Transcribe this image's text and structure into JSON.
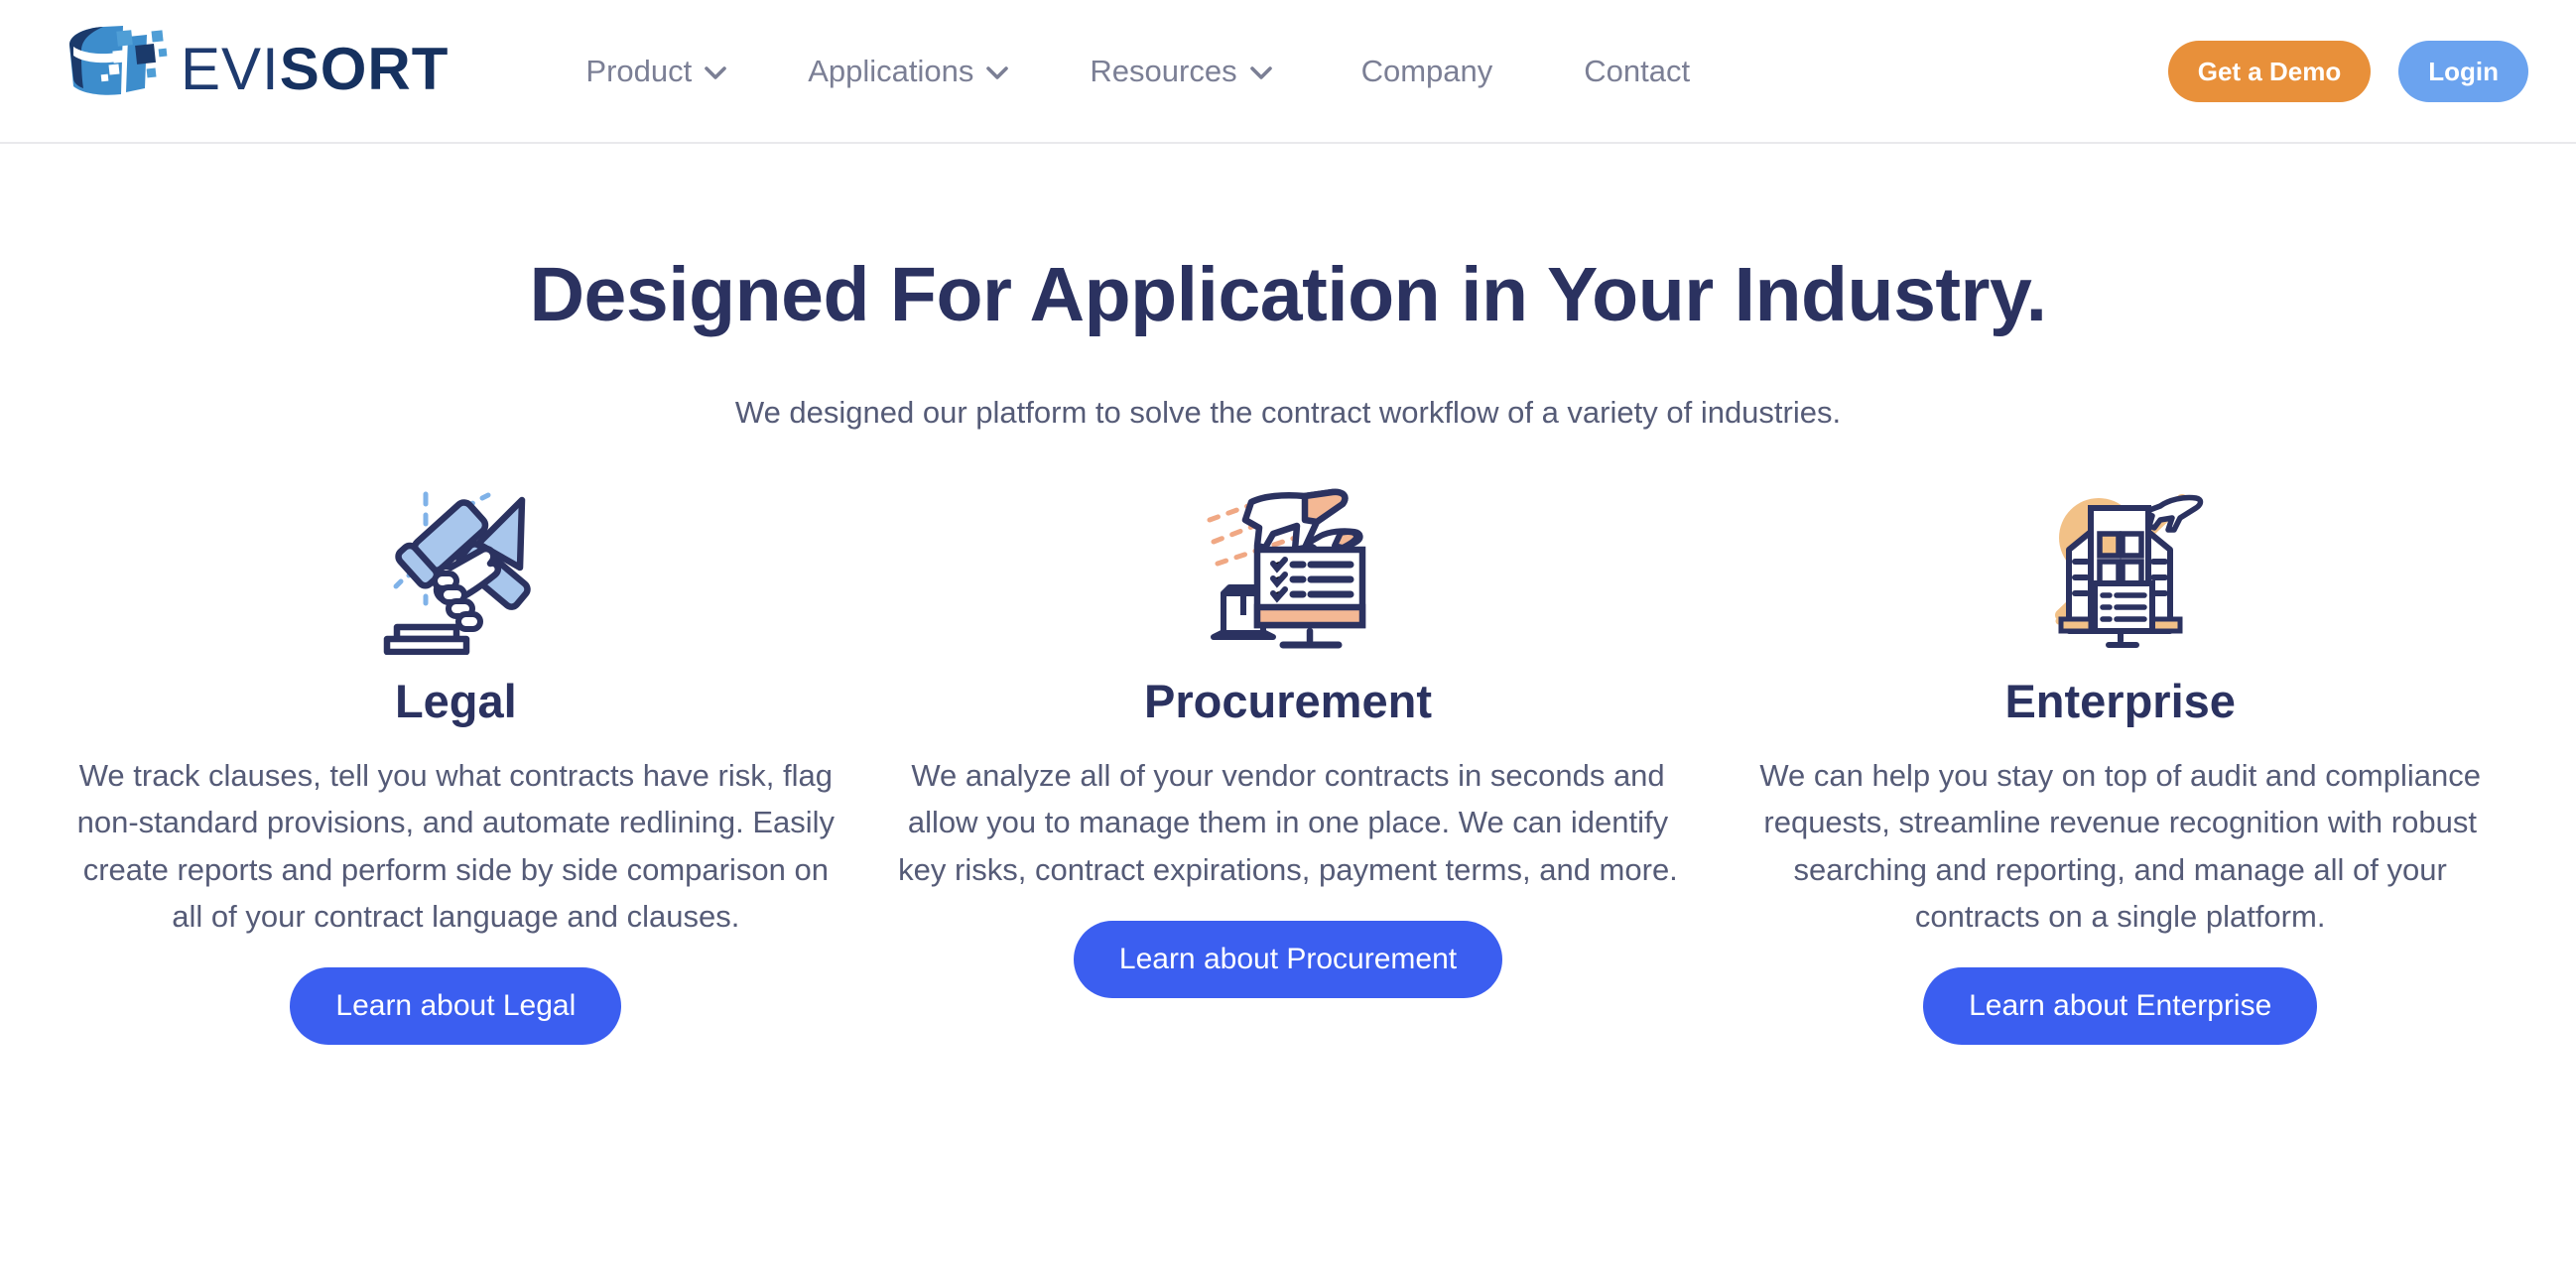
{
  "brand": {
    "name_light": "EVI",
    "name_bold": "SORT",
    "logo_icon": "evisort-cylinder-logo",
    "colors": {
      "logo_blue": "#3d8dcc",
      "logo_navy": "#1b3a6b",
      "heading_navy": "#2b3260",
      "body_gray": "#555b77",
      "nav_gray": "#7b7f95",
      "cta_blue": "#3b5ef0",
      "demo_orange": "#e8903a",
      "login_blue": "#6ba3ef",
      "icon_navy": "#2b3260",
      "icon_blue": "#a8c6ec",
      "icon_peach": "#f4b894",
      "icon_tan": "#f2c187"
    }
  },
  "nav": {
    "items": [
      {
        "label": "Product",
        "has_dropdown": true,
        "icon": "chevron-down-icon"
      },
      {
        "label": "Applications",
        "has_dropdown": true,
        "icon": "chevron-down-icon"
      },
      {
        "label": "Resources",
        "has_dropdown": true,
        "icon": "chevron-down-icon"
      },
      {
        "label": "Company",
        "has_dropdown": false,
        "icon": ""
      },
      {
        "label": "Contact",
        "has_dropdown": false,
        "icon": ""
      }
    ],
    "demo_label": "Get a Demo",
    "login_label": "Login"
  },
  "hero": {
    "title": "Designed For Application in Your Industry.",
    "subtitle": "We designed our platform to solve the contract workflow of a variety of industries."
  },
  "cards": [
    {
      "icon": "gavel-icon",
      "title": "Legal",
      "body": "We track clauses, tell you what contracts have risk, flag non-standard provisions, and automate redlining. Easily create reports and perform side by side comparison on all of your contract language and clauses.",
      "cta": "Learn about Legal"
    },
    {
      "icon": "airplane-monitor-checklist-icon",
      "title": "Procurement",
      "body": "We analyze all of your vendor contracts in seconds and allow you to manage them in one place. We can identify key risks, contract expirations, payment terms, and more.",
      "cta": "Learn about Procurement"
    },
    {
      "icon": "office-buildings-icon",
      "title": "Enterprise",
      "body": "We can help you stay on top of audit and compliance requests, streamline revenue recognition with robust searching and reporting, and manage all of your contracts on a single platform.",
      "cta": "Learn about Enterprise"
    }
  ]
}
